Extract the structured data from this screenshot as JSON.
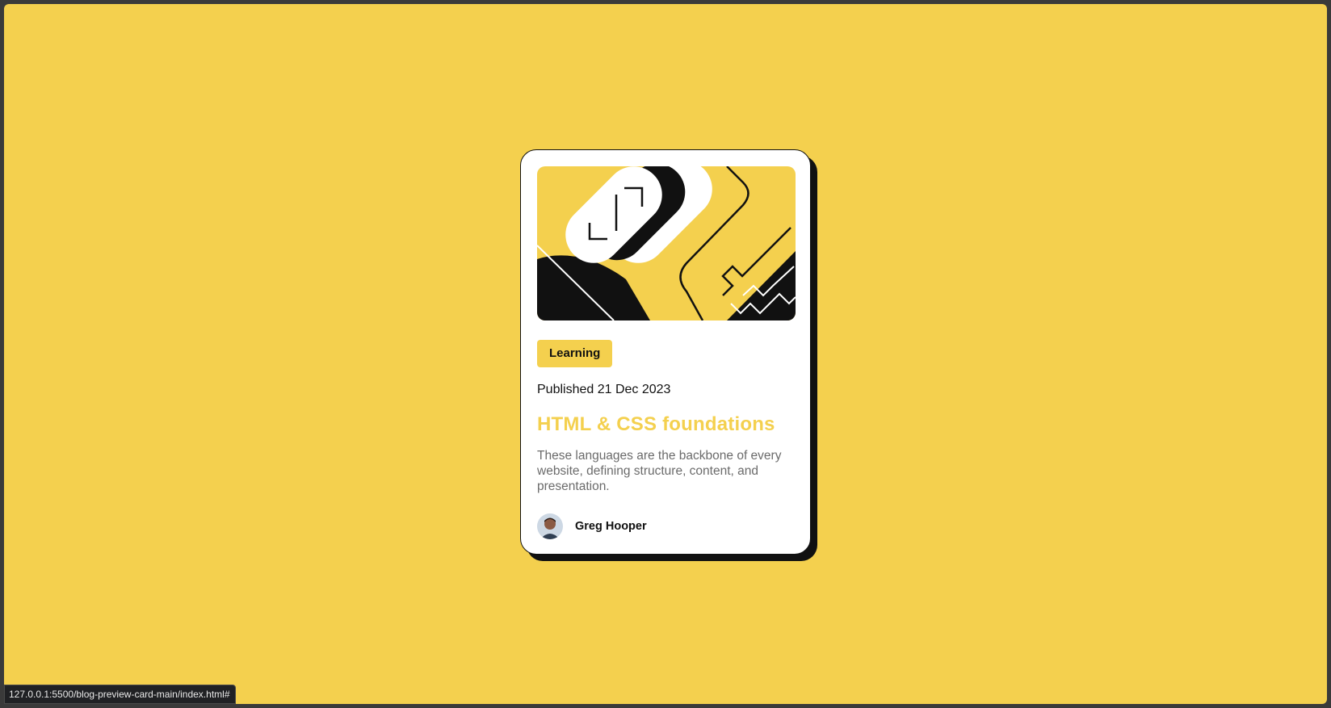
{
  "page": {
    "background_color": "#f4d04e",
    "accent_color": "#f4d04e",
    "text_dark": "#111111"
  },
  "card": {
    "image_icon": "hero-illustration",
    "tag": "Learning",
    "published": "Published 21 Dec 2023",
    "title": "HTML & CSS foundations",
    "description": "These languages are the backbone of every website, defining structure, content, and presentation.",
    "author": {
      "avatar_icon": "avatar-image",
      "name": "Greg Hooper"
    }
  },
  "status_bar": {
    "url": "127.0.0.1:5500/blog-preview-card-main/index.html#"
  }
}
